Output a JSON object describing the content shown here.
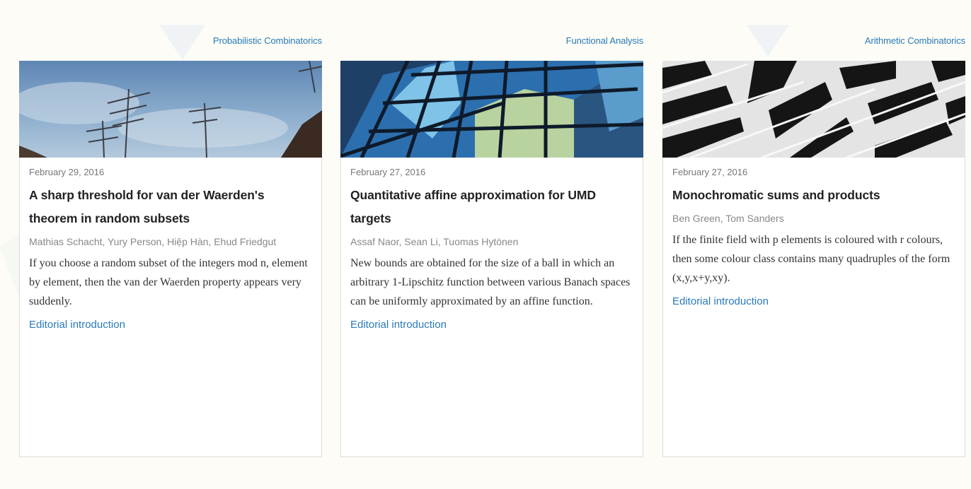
{
  "articles": [
    {
      "category": "Probabilistic Combinatorics",
      "image_icon": "antennas-sky-photo",
      "date": "February 29, 2016",
      "title": "A sharp threshold for van der Waerden's theorem in random subsets",
      "authors": "Mathias Schacht, Yury Person, Hiệp Hàn, Ehud Friedgut",
      "abstract": "If you choose a random subset of the integers mod n, element by element, then the van der Waerden property appears very suddenly.",
      "link": "Editorial introduction"
    },
    {
      "category": "Functional Analysis",
      "image_icon": "glass-facade-photo",
      "date": "February 27, 2016",
      "title": "Quantitative affine approximation for UMD targets",
      "authors": "Assaf Naor, Sean Li, Tuomas Hytönen",
      "abstract": "New bounds are obtained for the size of a ball in which an arbitrary 1-Lipschitz function between various Banach spaces can be uniformly approximated by an affine function.",
      "link": "Editorial introduction"
    },
    {
      "category": "Arithmetic Combinatorics",
      "image_icon": "building-balconies-photo",
      "date": "February 27, 2016",
      "title": "Monochromatic sums and products",
      "authors": "Ben Green, Tom Sanders",
      "abstract": "If the finite field with p elements is coloured with r colours, then some colour class contains many quadruples of the form (x,y,x+y,xy).",
      "link": "Editorial introduction"
    }
  ],
  "colors": {
    "link": "#2a7ab8",
    "background": "#fdfcf6",
    "card_border": "#dcdcdc"
  }
}
